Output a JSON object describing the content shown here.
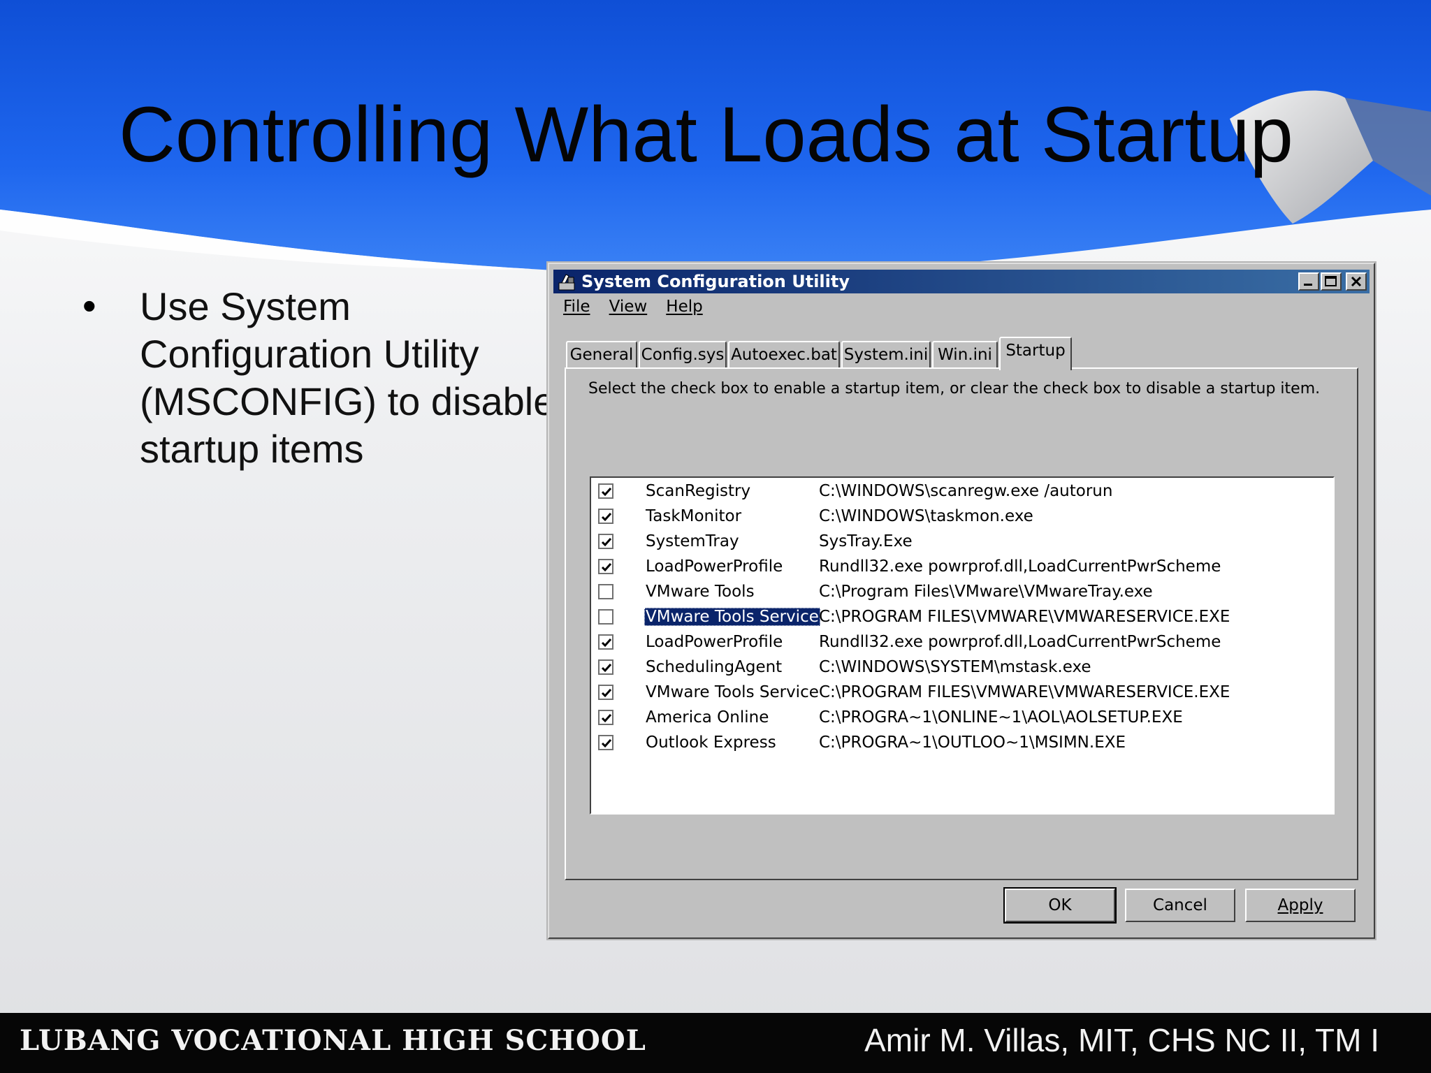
{
  "slide": {
    "title": "Controlling What Loads at Startup",
    "bullets": [
      "Use System Configuration Utility (MSCONFIG) to disable startup items"
    ],
    "footer_left": "LUBANG VOCATIONAL HIGH SCHOOL",
    "footer_right": "Amir M. Villas, MIT,  CHS NC II, TM I"
  },
  "window": {
    "title": "System Configuration Utility",
    "menus": [
      "File",
      "View",
      "Help"
    ],
    "tabs": [
      "General",
      "Config.sys",
      "Autoexec.bat",
      "System.ini",
      "Win.ini",
      "Startup"
    ],
    "active_tab": "Startup",
    "description": "Select the check box to enable a startup item, or clear the check box to disable a startup item.",
    "items": [
      {
        "name": "ScanRegistry",
        "command": "C:\\WINDOWS\\scanregw.exe /autorun",
        "checked": true
      },
      {
        "name": "TaskMonitor",
        "command": "C:\\WINDOWS\\taskmon.exe",
        "checked": true
      },
      {
        "name": "SystemTray",
        "command": "SysTray.Exe",
        "checked": true
      },
      {
        "name": "LoadPowerProfile",
        "command": "Rundll32.exe powrprof.dll,LoadCurrentPwrScheme",
        "checked": true
      },
      {
        "name": "VMware Tools",
        "command": "C:\\Program Files\\VMware\\VMwareTray.exe",
        "checked": false
      },
      {
        "name": "VMware Tools Service",
        "command": "C:\\PROGRAM FILES\\VMWARE\\VMWARESERVICE.EXE",
        "checked": false,
        "selected": true
      },
      {
        "name": "LoadPowerProfile",
        "command": "Rundll32.exe powrprof.dll,LoadCurrentPwrScheme",
        "checked": true
      },
      {
        "name": "SchedulingAgent",
        "command": "C:\\WINDOWS\\SYSTEM\\mstask.exe",
        "checked": true
      },
      {
        "name": "VMware Tools Service",
        "command": "C:\\PROGRAM FILES\\VMWARE\\VMWARESERVICE.EXE",
        "checked": true
      },
      {
        "name": "America Online",
        "command": "C:\\PROGRA~1\\ONLINE~1\\AOL\\AOLSETUP.EXE",
        "checked": true
      },
      {
        "name": "Outlook Express",
        "command": "C:\\PROGRA~1\\OUTLOO~1\\MSIMN.EXE",
        "checked": true
      }
    ],
    "buttons": {
      "ok": "OK",
      "cancel": "Cancel",
      "apply": "Apply"
    }
  },
  "colors": {
    "banner_blue": "#1a5fe0",
    "titlebar": "#0a246a",
    "selection": "#0a246a",
    "footer": "#060606"
  }
}
